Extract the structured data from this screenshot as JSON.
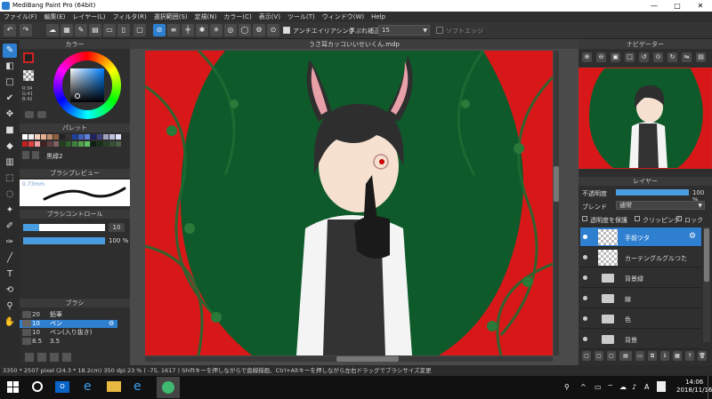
{
  "app": {
    "title": "MediBang Paint Pro (64bit)"
  },
  "menu": [
    "ファイル(F)",
    "編集(E)",
    "レイヤー(L)",
    "フィルタ(R)",
    "選択範囲(S)",
    "定規(N)",
    "カラー(C)",
    "表示(V)",
    "ツール(T)",
    "ウィンドウ(W)",
    "Help"
  ],
  "toolbar": {
    "antialias_label": "アンチエイリアシング",
    "stabilizer_label": "手ぶれ補正",
    "stabilizer_value": "15",
    "softedge_label": "ソフトエッジ"
  },
  "panels": {
    "color": "カラー",
    "palette": "パレット",
    "palette_name": "黒緑2",
    "brush_preview": "ブラシプレビュー",
    "brush_preview_size": "0.73mm",
    "brush_control": "ブラシコントロール",
    "brush_size": "10",
    "brush_opacity": "100 %",
    "brush": "ブラシ",
    "navigator": "ナビゲーター",
    "layer": "レイヤー"
  },
  "color_values": {
    "r": "R:34",
    "g": "G:41",
    "b": "B:42"
  },
  "document": {
    "tab": "うさ耳カッコいいせいくん.mdp"
  },
  "brushes": [
    {
      "size": "20",
      "name": "鉛筆"
    },
    {
      "size": "10",
      "name": "ペン"
    },
    {
      "size": "10",
      "name": "ペン(入り抜き)"
    },
    {
      "size": "8.5",
      "name": "3.5"
    }
  ],
  "layers": {
    "opacity_label": "不透明度",
    "opacity_value": "100 %",
    "blend_label": "ブレンド",
    "blend_value": "通常",
    "protect_label": "透明度を保護",
    "clipping_label": "クリッピング",
    "lock_label": "ロック",
    "items": [
      "手前ツタ",
      "カーテングルグルつた",
      "背景緑",
      "線",
      "色",
      "背景"
    ]
  },
  "status": "3350 * 2507 pixel   (24.3 * 18.2cm)   350 dpi   23 %   ( -75, 1617 )   Shiftキーを押しながらで直線描画、Ctrl+Altキーを押しながら左右ドラッグでブラシサイズ変更",
  "clock": {
    "time": "14:06",
    "date": "2018/11/16"
  },
  "colors": {
    "accent": "#2f7fd0",
    "panel": "#2e2e2e",
    "canvas_bg": "#e01818",
    "foliage": "#0f5a2a"
  }
}
